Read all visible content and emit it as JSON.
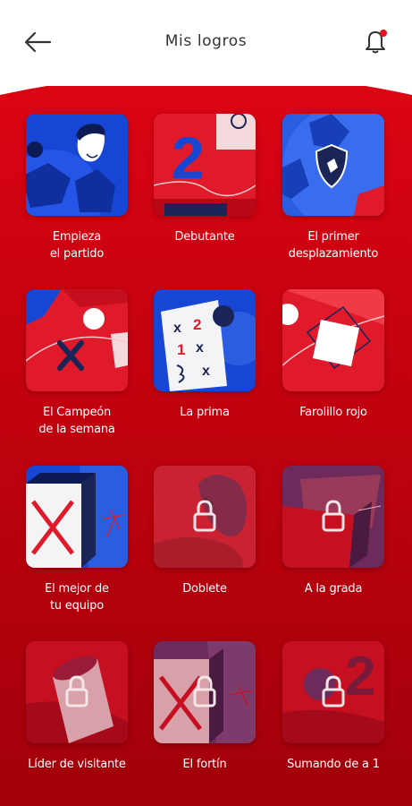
{
  "header": {
    "title": "Mis logros",
    "back_icon": "arrow-left-icon",
    "notification_icon": "bell-icon"
  },
  "colors": {
    "primary_red": "#d90011",
    "dark_red": "#9a0008",
    "blue": "#1746d4",
    "navy": "#1a2456",
    "notification_dot": "#e8101e"
  },
  "achievements": [
    {
      "label": "Empieza\nel partido",
      "locked": false
    },
    {
      "label": "Debutante",
      "locked": false
    },
    {
      "label": "El primer\ndesplazamiento",
      "locked": false
    },
    {
      "label": "El Campeón\nde la semana",
      "locked": false
    },
    {
      "label": "La prima",
      "locked": false
    },
    {
      "label": "Farolillo rojo",
      "locked": false
    },
    {
      "label": "El mejor de\ntu equipo",
      "locked": false
    },
    {
      "label": "Doblete",
      "locked": true
    },
    {
      "label": "A la grada",
      "locked": true
    },
    {
      "label": "Líder de visitante",
      "locked": true
    },
    {
      "label": "El fortín",
      "locked": true
    },
    {
      "label": "Sumando de a 1",
      "locked": true
    }
  ],
  "badge_art": {
    "debutante_number": "2",
    "prima_marks": [
      "x",
      "2",
      "1",
      "x",
      "x"
    ],
    "sumando_number": "2"
  }
}
